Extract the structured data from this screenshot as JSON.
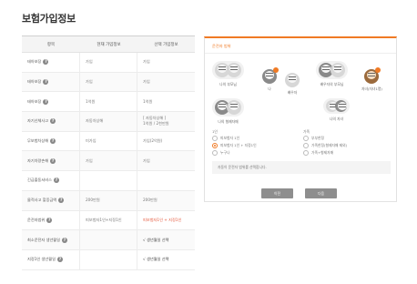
{
  "page": {
    "title": "보험가입정보"
  },
  "table": {
    "headers": [
      "항목",
      "현재 가입정보",
      "선택 가입정보"
    ],
    "rows": [
      {
        "label": "태아보장",
        "help": true,
        "current": "가입",
        "selected": "가입"
      },
      {
        "label": "태아보장",
        "help": true,
        "current": "가입",
        "selected": "가입"
      },
      {
        "label": "태아보장",
        "help": true,
        "current": "1억원",
        "selected": "1억원"
      },
      {
        "label": "자기신체사고",
        "help": true,
        "current": "자동차상해",
        "selected_line1": "[ 자동차상해 ]",
        "selected_line2": "1억원 / 2천만원"
      },
      {
        "label": "무보험차상해",
        "help": true,
        "current": "미가입",
        "selected": "가입(2억원)"
      },
      {
        "label": "자기차량손해",
        "help": true,
        "current": "가입",
        "selected": "가입"
      },
      {
        "label": "긴급출동서비스",
        "help": true,
        "current": "",
        "selected": ""
      },
      {
        "label": "물적사고 할증금액",
        "help": true,
        "current": "200만원",
        "selected": "200만원"
      },
      {
        "label": "운전자범위",
        "help": true,
        "current": "피보험자1인+지정1인",
        "selected": "피보험자1인 + 지정1인"
      },
      {
        "label": "최소운전자 생년월일",
        "help": true,
        "current": "",
        "selected": "√ 생년월일 선택"
      },
      {
        "label": "지정1인 생년월일",
        "help": true,
        "current": "",
        "selected": "√ 생년월일 선택"
      }
    ]
  },
  "panel": {
    "title": "운전자 범위",
    "members": [
      {
        "label": "나의 부모님"
      },
      {
        "label": "나"
      },
      {
        "label": "배우자"
      },
      {
        "label": "배우자의 부모님"
      },
      {
        "label": "자녀(자녀1명)"
      },
      {
        "label": "나의 형제자매"
      },
      {
        "label": "나의 자녀"
      }
    ],
    "group1": {
      "label": "1인",
      "options": [
        "피보험자 1인",
        "피보험자 1인 + 지정1인",
        "누구나"
      ],
      "selected_index": 1
    },
    "group2": {
      "label": "가족",
      "options": [
        "부부한정",
        "가족한정(형제자매 제외)",
        "가족+형제자매"
      ],
      "selected_index": -1
    },
    "notice": "자동이 운전자 범위를 선택합니다.",
    "buttons": {
      "prev": "이전",
      "next": "다음"
    },
    "accent": "#f07a24"
  }
}
